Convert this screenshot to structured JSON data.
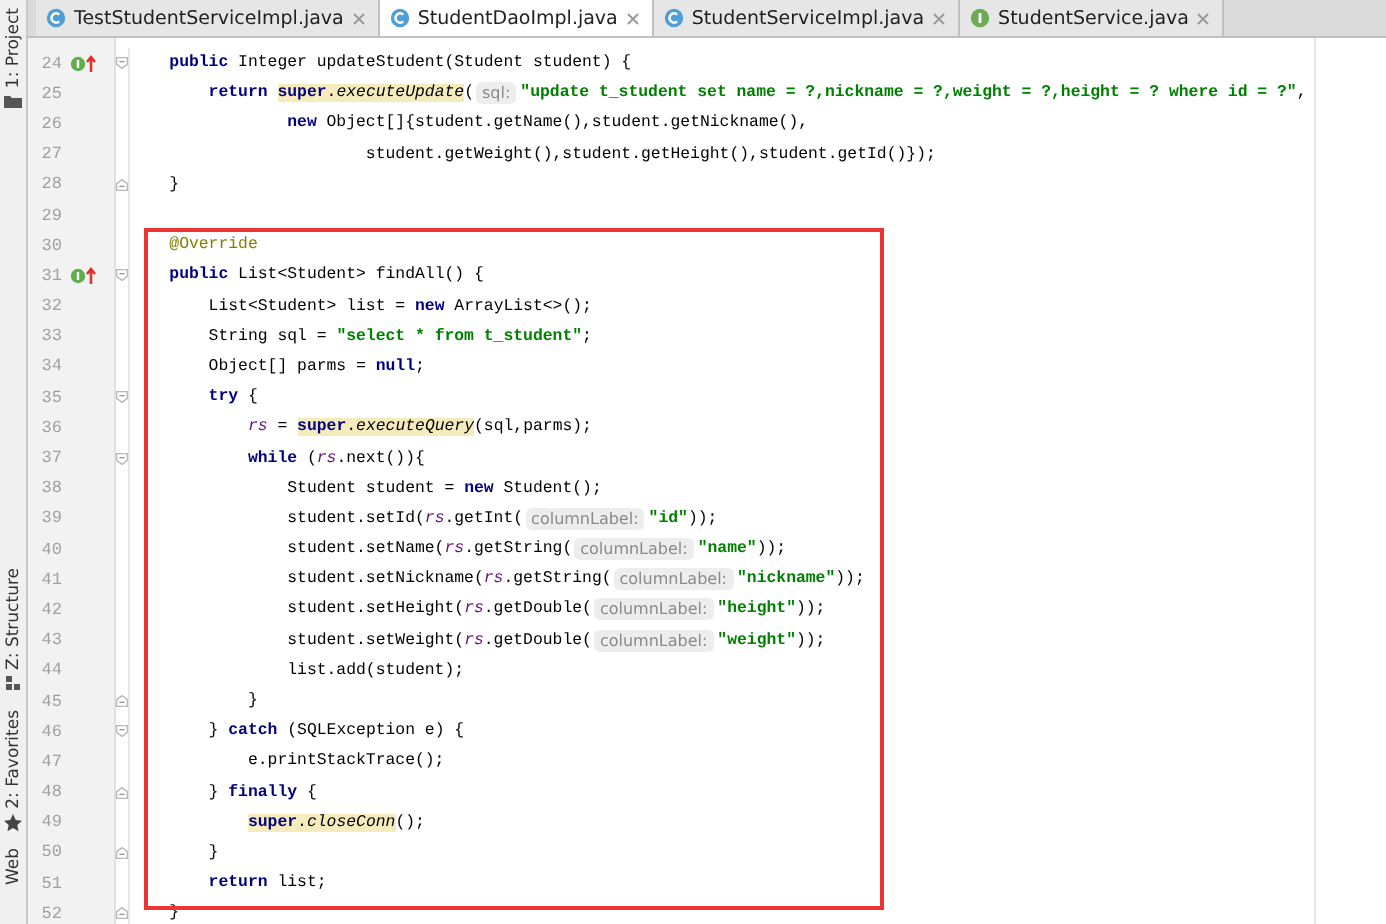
{
  "side_strip": [
    {
      "kind": "project",
      "label": "1: Project"
    },
    {
      "kind": "structure",
      "label": "Z: Structure"
    },
    {
      "kind": "favorites",
      "label": "2: Favorites"
    },
    {
      "kind": "web",
      "label": "Web"
    }
  ],
  "tabs": [
    {
      "label": "TestStudentServiceImpl.java",
      "kind": "class",
      "selected": false
    },
    {
      "label": "StudentDaoImpl.java",
      "kind": "class",
      "selected": true
    },
    {
      "label": "StudentServiceImpl.java",
      "kind": "class",
      "selected": false
    },
    {
      "label": "StudentService.java",
      "kind": "interface",
      "selected": false
    }
  ],
  "lines": [
    {
      "number": "24",
      "override": true,
      "fold_start": true,
      "fold_end": false,
      "boxed": false,
      "tokens": [
        {
          "kind": "kw",
          "text": "    public"
        },
        {
          "kind": "plain",
          "text": " Integer updateStudent(Student student) {"
        }
      ]
    },
    {
      "number": "25",
      "override": false,
      "fold_start": false,
      "fold_end": false,
      "boxed": false,
      "tokens": [
        {
          "kind": "kw",
          "text": "        return "
        },
        {
          "kind": "hl",
          "parts": [
            {
              "kind": "kw",
              "text": "super"
            },
            {
              "kind": "plain",
              "text": "."
            },
            {
              "kind": "method",
              "text": "executeUpdate"
            }
          ]
        },
        {
          "kind": "plain",
          "text": "("
        },
        {
          "kind": "hint",
          "text": "sql:"
        },
        {
          "kind": "str",
          "text": "\"update t_student set name = ?,nickname = ?,weight = ?,height = ? where id = ?\""
        },
        {
          "kind": "plain",
          "text": ","
        }
      ]
    },
    {
      "number": "26",
      "override": false,
      "fold_start": false,
      "fold_end": false,
      "boxed": false,
      "tokens": [
        {
          "kind": "kw",
          "text": "                new"
        },
        {
          "kind": "plain",
          "text": " Object[]{student.getName(),student.getNickname(),"
        }
      ]
    },
    {
      "number": "27",
      "override": false,
      "fold_start": false,
      "fold_end": false,
      "boxed": false,
      "tokens": [
        {
          "kind": "plain",
          "text": "                        student.getWeight(),student.getHeight(),student.getId()});"
        }
      ]
    },
    {
      "number": "28",
      "override": false,
      "fold_start": false,
      "fold_end": true,
      "boxed": false,
      "tokens": [
        {
          "kind": "plain",
          "text": "    }"
        }
      ]
    },
    {
      "number": "29",
      "override": false,
      "fold_start": false,
      "fold_end": false,
      "boxed": false
    },
    {
      "number": "30",
      "override": false,
      "fold_start": false,
      "fold_end": false,
      "boxed": true,
      "tokens": [
        {
          "kind": "ann",
          "text": "    @Override"
        }
      ]
    },
    {
      "number": "31",
      "override": true,
      "fold_start": true,
      "fold_end": false,
      "boxed": true,
      "tokens": [
        {
          "kind": "kw",
          "text": "    public"
        },
        {
          "kind": "plain",
          "text": " List<Student> findAll() {"
        }
      ]
    },
    {
      "number": "32",
      "override": false,
      "fold_start": false,
      "fold_end": false,
      "boxed": true,
      "tokens": [
        {
          "kind": "plain",
          "text": "        List<Student> list = "
        },
        {
          "kind": "kw",
          "text": "new"
        },
        {
          "kind": "plain",
          "text": " ArrayList<>();"
        }
      ]
    },
    {
      "number": "33",
      "override": false,
      "fold_start": false,
      "fold_end": false,
      "boxed": true,
      "tokens": [
        {
          "kind": "plain",
          "text": "        String sql = "
        },
        {
          "kind": "str",
          "text": "\"select * from t_student\""
        },
        {
          "kind": "plain",
          "text": ";"
        }
      ]
    },
    {
      "number": "34",
      "override": false,
      "fold_start": false,
      "fold_end": false,
      "boxed": true,
      "tokens": [
        {
          "kind": "plain",
          "text": "        Object[] parms = "
        },
        {
          "kind": "kw",
          "text": "null"
        },
        {
          "kind": "plain",
          "text": ";"
        }
      ]
    },
    {
      "number": "35",
      "override": false,
      "fold_start": true,
      "fold_end": false,
      "boxed": true,
      "tokens": [
        {
          "kind": "kw",
          "text": "        try"
        },
        {
          "kind": "plain",
          "text": " {"
        }
      ]
    },
    {
      "number": "36",
      "override": false,
      "fold_start": false,
      "fold_end": false,
      "boxed": true,
      "tokens": [
        {
          "kind": "field",
          "text": "            rs"
        },
        {
          "kind": "plain",
          "text": " = "
        },
        {
          "kind": "hl",
          "parts": [
            {
              "kind": "kw",
              "text": "super"
            },
            {
              "kind": "plain",
              "text": "."
            },
            {
              "kind": "method",
              "text": "executeQuery"
            }
          ]
        },
        {
          "kind": "plain",
          "text": "(sql,parms);"
        }
      ]
    },
    {
      "number": "37",
      "override": false,
      "fold_start": true,
      "fold_end": false,
      "boxed": true,
      "tokens": [
        {
          "kind": "kw",
          "text": "            while"
        },
        {
          "kind": "plain",
          "text": " ("
        },
        {
          "kind": "field",
          "text": "rs"
        },
        {
          "kind": "plain",
          "text": ".next()){"
        }
      ]
    },
    {
      "number": "38",
      "override": false,
      "fold_start": false,
      "fold_end": false,
      "boxed": true,
      "tokens": [
        {
          "kind": "plain",
          "text": "                Student student = "
        },
        {
          "kind": "kw",
          "text": "new"
        },
        {
          "kind": "plain",
          "text": " Student();"
        }
      ]
    },
    {
      "number": "39",
      "override": false,
      "fold_start": false,
      "fold_end": false,
      "boxed": true,
      "tokens": [
        {
          "kind": "plain",
          "text": "                student.setId("
        },
        {
          "kind": "field",
          "text": "rs"
        },
        {
          "kind": "plain",
          "text": ".getInt("
        },
        {
          "kind": "hint",
          "text": "columnLabel:"
        },
        {
          "kind": "str",
          "text": "\"id\""
        },
        {
          "kind": "plain",
          "text": "));"
        }
      ]
    },
    {
      "number": "40",
      "override": false,
      "fold_start": false,
      "fold_end": false,
      "boxed": true,
      "tokens": [
        {
          "kind": "plain",
          "text": "                student.setName("
        },
        {
          "kind": "field",
          "text": "rs"
        },
        {
          "kind": "plain",
          "text": ".getString("
        },
        {
          "kind": "hint",
          "text": "columnLabel:"
        },
        {
          "kind": "str",
          "text": "\"name\""
        },
        {
          "kind": "plain",
          "text": "));"
        }
      ]
    },
    {
      "number": "41",
      "override": false,
      "fold_start": false,
      "fold_end": false,
      "boxed": true,
      "tokens": [
        {
          "kind": "plain",
          "text": "                student.setNickname("
        },
        {
          "kind": "field",
          "text": "rs"
        },
        {
          "kind": "plain",
          "text": ".getString("
        },
        {
          "kind": "hint",
          "text": "columnLabel:"
        },
        {
          "kind": "str",
          "text": "\"nickname\""
        },
        {
          "kind": "plain",
          "text": "));"
        }
      ]
    },
    {
      "number": "42",
      "override": false,
      "fold_start": false,
      "fold_end": false,
      "boxed": true,
      "tokens": [
        {
          "kind": "plain",
          "text": "                student.setHeight("
        },
        {
          "kind": "field",
          "text": "rs"
        },
        {
          "kind": "plain",
          "text": ".getDouble("
        },
        {
          "kind": "hint",
          "text": "columnLabel:"
        },
        {
          "kind": "str",
          "text": "\"height\""
        },
        {
          "kind": "plain",
          "text": "));"
        }
      ]
    },
    {
      "number": "43",
      "override": false,
      "fold_start": false,
      "fold_end": false,
      "boxed": true,
      "tokens": [
        {
          "kind": "plain",
          "text": "                student.setWeight("
        },
        {
          "kind": "field",
          "text": "rs"
        },
        {
          "kind": "plain",
          "text": ".getDouble("
        },
        {
          "kind": "hint",
          "text": "columnLabel:"
        },
        {
          "kind": "str",
          "text": "\"weight\""
        },
        {
          "kind": "plain",
          "text": "));"
        }
      ]
    },
    {
      "number": "44",
      "override": false,
      "fold_start": false,
      "fold_end": false,
      "boxed": true,
      "tokens": [
        {
          "kind": "plain",
          "text": "                list.add(student);"
        }
      ]
    },
    {
      "number": "45",
      "override": false,
      "fold_start": false,
      "fold_end": true,
      "boxed": true,
      "tokens": [
        {
          "kind": "plain",
          "text": "            }"
        }
      ]
    },
    {
      "number": "46",
      "override": false,
      "fold_start": true,
      "fold_end": false,
      "boxed": true,
      "tokens": [
        {
          "kind": "plain",
          "text": "        } "
        },
        {
          "kind": "kw",
          "text": "catch"
        },
        {
          "kind": "plain",
          "text": " (SQLException e) {"
        }
      ]
    },
    {
      "number": "47",
      "override": false,
      "fold_start": false,
      "fold_end": false,
      "boxed": true,
      "tokens": [
        {
          "kind": "plain",
          "text": "            e.printStackTrace();"
        }
      ]
    },
    {
      "number": "48",
      "override": false,
      "fold_start": false,
      "fold_end": true,
      "boxed": true,
      "tokens": [
        {
          "kind": "plain",
          "text": "        } "
        },
        {
          "kind": "kw",
          "text": "finally"
        },
        {
          "kind": "plain",
          "text": " {"
        }
      ]
    },
    {
      "number": "49",
      "override": false,
      "fold_start": false,
      "fold_end": false,
      "boxed": true,
      "tokens": [
        {
          "kind": "hl",
          "parts": [
            {
              "kind": "kw",
              "text": "            super"
            },
            {
              "kind": "plain",
              "text": "."
            },
            {
              "kind": "method",
              "text": "closeConn"
            }
          ]
        },
        {
          "kind": "plain",
          "text": "();"
        }
      ]
    },
    {
      "number": "50",
      "override": false,
      "fold_start": false,
      "fold_end": true,
      "boxed": true,
      "tokens": [
        {
          "kind": "plain",
          "text": "        }"
        }
      ]
    },
    {
      "number": "51",
      "override": false,
      "fold_start": false,
      "fold_end": false,
      "boxed": true,
      "tokens": [
        {
          "kind": "kw",
          "text": "        return"
        },
        {
          "kind": "plain",
          "text": " list;"
        }
      ]
    },
    {
      "number": "52",
      "override": false,
      "fold_start": false,
      "fold_end": true,
      "boxed": false,
      "tokens": [
        {
          "kind": "plain",
          "text": "    }"
        }
      ]
    }
  ]
}
